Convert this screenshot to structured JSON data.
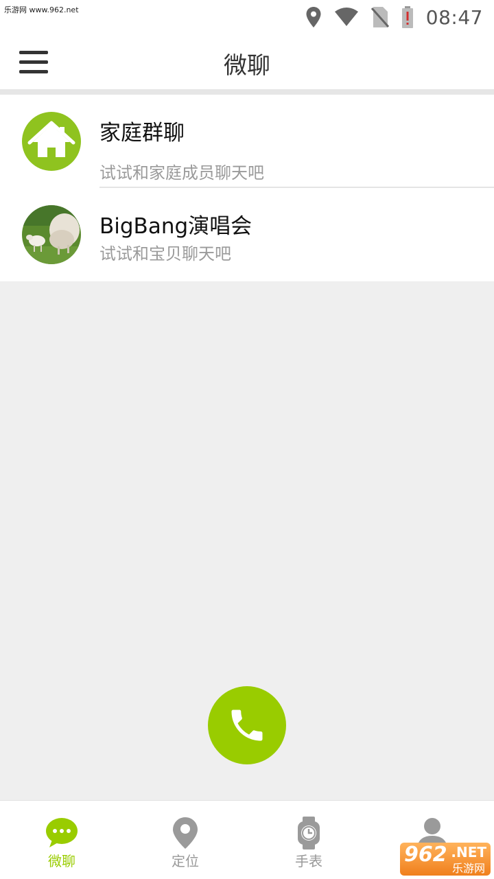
{
  "status_bar": {
    "watermark": "乐游网 www.962.net",
    "time": "08:47",
    "icons": [
      "location-icon",
      "wifi-icon",
      "no-sim-icon",
      "battery-alert-icon"
    ]
  },
  "app_bar": {
    "title": "微聊",
    "menu_icon": "menu-icon"
  },
  "chats": [
    {
      "name": "家庭群聊",
      "subtitle": "试试和家庭成员聊天吧",
      "avatar_icon": "home-icon",
      "avatar_color": "#8fc31f"
    },
    {
      "name": "BigBang演唱会",
      "subtitle": "试试和宝贝聊天吧",
      "avatar_icon": "sheep-photo"
    }
  ],
  "fab": {
    "icon": "phone-icon",
    "color": "#99cc00"
  },
  "bottom_nav": {
    "items": [
      {
        "label": "微聊",
        "icon": "chat-bubble-icon",
        "active": true
      },
      {
        "label": "定位",
        "icon": "location-pin-icon",
        "active": false
      },
      {
        "label": "手表",
        "icon": "watch-icon",
        "active": false
      },
      {
        "label": "",
        "icon": "person-icon",
        "active": false
      }
    ],
    "active_color": "#99cc00",
    "inactive_color": "#999999"
  },
  "watermark_badge": {
    "number": "962",
    "net": ".NET",
    "sub": "乐游网"
  }
}
